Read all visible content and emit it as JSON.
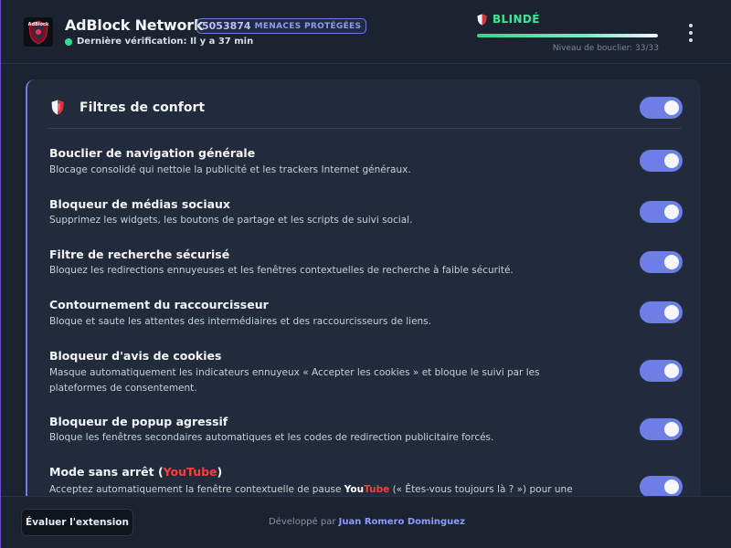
{
  "header": {
    "app_title": "AdBlock Network",
    "threat_count": "5053874",
    "threat_label": "MENACES PROTÉGÉES",
    "last_check": "Dernière vérification: Il y a 37 min",
    "shield_status": "BLINDÉ",
    "shield_level_text": "Niveau de bouclier: 33/33",
    "shield_level_fraction": 1.0,
    "colors": {
      "accent": "#6d7fe6",
      "status_ok": "#3ee896"
    }
  },
  "card": {
    "title": "Filtres de confort",
    "master_toggle": true,
    "items": [
      {
        "title": "Bouclier de navigation générale",
        "desc": "Blocage consolidé qui nettoie la publicité et les trackers Internet généraux.",
        "enabled": true
      },
      {
        "title": "Bloqueur de médias sociaux",
        "desc": "Supprimez les widgets, les boutons de partage et les scripts de suivi social.",
        "enabled": true
      },
      {
        "title": "Filtre de recherche sécurisé",
        "desc": "Bloquez les redirections ennuyeuses et les fenêtres contextuelles de recherche à faible sécurité.",
        "enabled": true
      },
      {
        "title": "Contournement du raccourcisseur",
        "desc": "Bloque et saute les attentes des intermédiaires et des raccourcisseurs de liens.",
        "enabled": true
      },
      {
        "title": "Bloqueur d'avis de cookies",
        "desc": "Masque automatiquement les indicateurs ennuyeux « Accepter les cookies » et bloque le suivi par les plateformes de consentement.",
        "enabled": true
      },
      {
        "title": "Bloqueur de popup agressif",
        "desc": "Bloque les fenêtres secondaires automatiques et les codes de redirection publicitaire forcés.",
        "enabled": true
      },
      {
        "title_prefix": "Mode sans arrêt (",
        "title_you": "You",
        "title_tube": "Tube",
        "title_suffix": ")",
        "desc_prefix": "Acceptez automatiquement la fenêtre contextuelle de pause ",
        "desc_you": "You",
        "desc_tube": "Tube",
        "desc_suffix": " (« Êtes-vous toujours là ? ») pour une",
        "enabled": true
      }
    ]
  },
  "footer": {
    "rate_button": "Évaluer l'extension",
    "dev_prefix": "Développé par",
    "dev_name": "Juan Romero Dominguez"
  }
}
